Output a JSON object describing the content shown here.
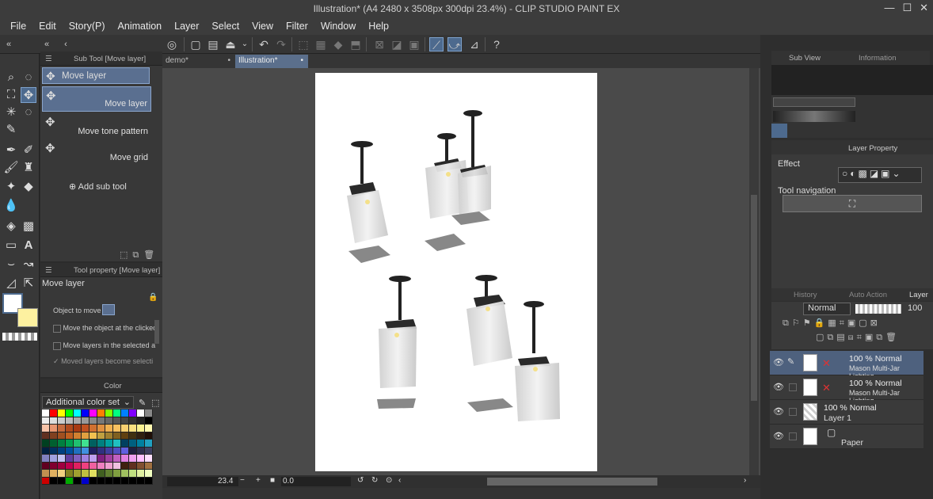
{
  "window": {
    "title": "Illustration* (A4 2480 x 3508px 300dpi 23.4%) - CLIP STUDIO PAINT EX",
    "minimize": "—",
    "maximize": "☐",
    "close": "✕"
  },
  "menu": [
    "File",
    "Edit",
    "Story(P)",
    "Animation",
    "Layer",
    "Select",
    "View",
    "Filter",
    "Window",
    "Help"
  ],
  "subtool_panel": {
    "header": "Sub Tool [Move layer]",
    "group_label": "Move layer",
    "items": [
      "Move layer",
      "Move tone pattern",
      "Move grid"
    ],
    "add_label": "Add sub tool"
  },
  "toolprop_panel": {
    "header": "Tool property [Move layer]",
    "tool_name": "Move layer",
    "rows": [
      "Object to move",
      "Move the object at the clicked",
      "Move layers in the selected a",
      "Moved layers become selecti"
    ]
  },
  "color_panel": {
    "tab": "Color",
    "set_name": "Additional color set"
  },
  "canvas": {
    "tabs": [
      "demo*",
      "Illustration*"
    ],
    "zoom": "23.4",
    "angle": "0.0"
  },
  "right": {
    "subview_tab": "Sub View",
    "info_tab": "Information",
    "layer_property_tab": "Layer Property",
    "effect_label": "Effect",
    "nav_label": "Tool navigation",
    "history_tab": "History",
    "auto_action_tab": "Auto Action",
    "layer_tab": "Layer",
    "blend_mode": "Normal",
    "opacity": "100"
  },
  "layers": [
    {
      "line1": "100 % Normal",
      "line2": "Mason Multi-Jar Lighting",
      "selected": true
    },
    {
      "line1": "100 % Normal",
      "line2": "Mason Multi-Jar Lighting",
      "selected": false
    },
    {
      "line1": "100 % Normal",
      "line2": "Layer 1",
      "selected": false
    },
    {
      "line1": "",
      "line2": "Paper",
      "selected": false
    }
  ],
  "colors": {
    "accent": "#5b6f8c",
    "selected_tool": "#4d6a8e",
    "foreground_color": "#ffffff",
    "background_color": "#fdf1a0"
  }
}
